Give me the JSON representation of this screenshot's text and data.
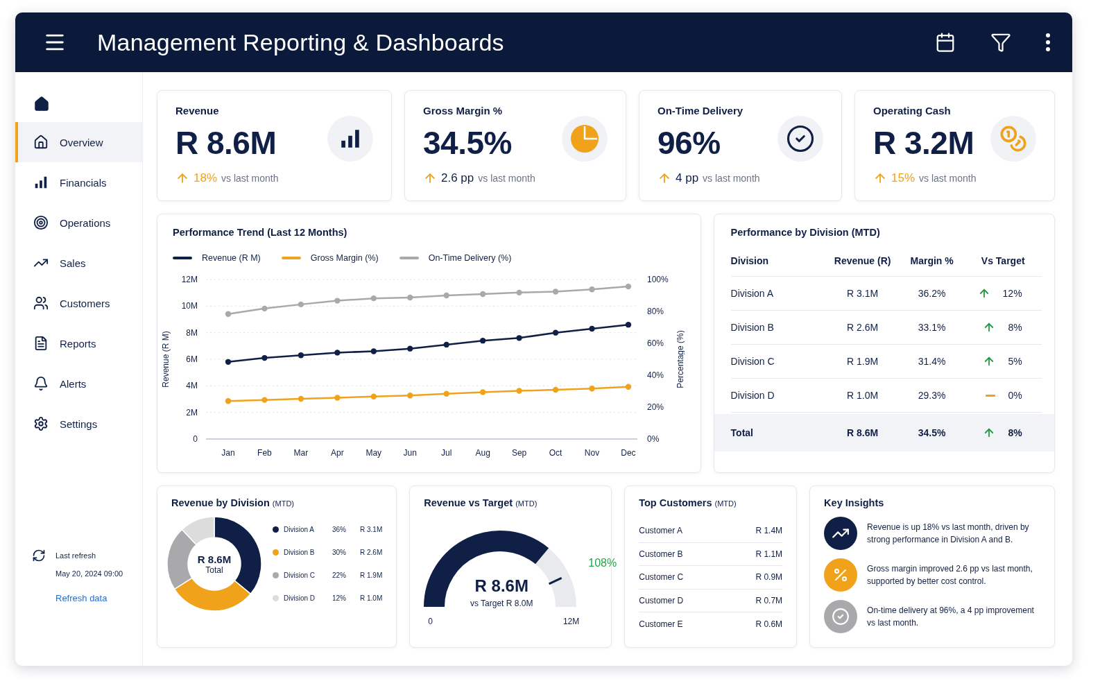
{
  "header": {
    "title": "Management Reporting & Dashboards"
  },
  "sidebar": {
    "items": [
      {
        "label": "Overview",
        "kind": "home",
        "selected": true
      },
      {
        "label": "Financials",
        "kind": "bars",
        "selected": false
      },
      {
        "label": "Operations",
        "kind": "target",
        "selected": false
      },
      {
        "label": "Sales",
        "kind": "trend",
        "selected": false
      },
      {
        "label": "Customers",
        "kind": "users",
        "selected": false
      },
      {
        "label": "Reports",
        "kind": "file",
        "selected": false
      },
      {
        "label": "Alerts",
        "kind": "bell",
        "selected": false
      },
      {
        "label": "Settings",
        "kind": "gear",
        "selected": false
      }
    ],
    "footer": {
      "label": "Last refresh",
      "timestamp": "May 20, 2024 09:00",
      "link": "Refresh data"
    }
  },
  "kpis": [
    {
      "label": "Revenue",
      "value": "R 8.6M",
      "kind": "bars",
      "delta": "18%",
      "highlight": true,
      "suffix": "vs last month"
    },
    {
      "label": "Gross Margin %",
      "value": "34.5%",
      "kind": "pie",
      "delta": "2.6 pp",
      "highlight": false,
      "suffix": "vs last month"
    },
    {
      "label": "On-Time Delivery",
      "value": "96%",
      "kind": "check",
      "delta": "4 pp",
      "highlight": false,
      "suffix": "vs last month"
    },
    {
      "label": "Operating Cash",
      "value": "R 3.2M",
      "kind": "coins",
      "delta": "15%",
      "highlight": true,
      "suffix": "vs last month"
    }
  ],
  "trend": {
    "title": "Performance Trend (Last 12 Months)",
    "chart_data": {
      "type": "line",
      "ylabel": "Revenue (R M)",
      "y2label": "Percentage (%)",
      "grid": true,
      "categories": [
        "Jan",
        "Feb",
        "Mar",
        "Apr",
        "May",
        "Jun",
        "Jul",
        "Aug",
        "Sep",
        "Oct",
        "Nov",
        "Dec"
      ],
      "ylim": [
        0,
        12
      ],
      "yticks": [
        {
          "value": 0,
          "label": "0"
        },
        {
          "value": 2,
          "label": "2M"
        },
        {
          "value": 4,
          "label": "4M"
        },
        {
          "value": 6,
          "label": "6M"
        },
        {
          "value": 8,
          "label": "8M"
        },
        {
          "value": 10,
          "label": "10M"
        },
        {
          "value": 12,
          "label": "12M"
        }
      ],
      "y2lim": [
        0,
        100
      ],
      "y2ticks": [
        {
          "value": 0,
          "label": "0%"
        },
        {
          "value": 20,
          "label": "20%"
        },
        {
          "value": 40,
          "label": "40%"
        },
        {
          "value": 60,
          "label": "60%"
        },
        {
          "value": 80,
          "label": "80%"
        },
        {
          "value": 100,
          "label": "100%"
        }
      ],
      "series": [
        {
          "name": "Revenue (R M)",
          "color": "#0f1f45",
          "marker": true,
          "values": [
            5.8,
            6.1,
            6.3,
            6.5,
            6.6,
            6.8,
            7.1,
            7.4,
            7.6,
            8.0,
            8.3,
            8.6
          ]
        },
        {
          "name": "Gross Margin (%)",
          "color": "#f0a21b",
          "axis": "y2",
          "marker": true,
          "values": [
            23.8,
            24.5,
            25.2,
            25.9,
            26.6,
            27.3,
            28.4,
            29.4,
            30.2,
            30.9,
            31.6,
            32.7
          ]
        },
        {
          "name": "On-Time Delivery (%)",
          "color": "#a9a9ab",
          "axis": "y2",
          "marker": true,
          "values": [
            78.4,
            81.8,
            84.4,
            86.7,
            88.2,
            88.7,
            90,
            90.9,
            91.8,
            92.4,
            93.8,
            95.6
          ]
        }
      ]
    }
  },
  "division_table": {
    "title": "Performance by Division (MTD)",
    "columns": [
      "Division",
      "Revenue (R)",
      "Margin %",
      "Vs Target"
    ],
    "rows": [
      {
        "cells": [
          "Division A",
          "R 3.1M",
          "36.2%"
        ],
        "kind": "up",
        "change": "12%",
        "total": false
      },
      {
        "cells": [
          "Division B",
          "R 2.6M",
          "33.1%"
        ],
        "kind": "up",
        "change": "8%",
        "total": false
      },
      {
        "cells": [
          "Division C",
          "R 1.9M",
          "31.4%"
        ],
        "kind": "up",
        "change": "5%",
        "total": false
      },
      {
        "cells": [
          "Division D",
          "R 1.0M",
          "29.3%"
        ],
        "kind": "flat",
        "change": "0%",
        "total": false
      },
      {
        "cells": [
          "Total",
          "R 8.6M",
          "34.5%"
        ],
        "kind": "up",
        "change": "8%",
        "total": true
      }
    ]
  },
  "revenue_by_division": {
    "title": "Revenue by Division",
    "tag": "(MTD)",
    "center_value": "R 8.6M",
    "center_label": "Total",
    "chart_data": {
      "type": "donut",
      "categories": [
        "Division A",
        "Division B",
        "Division C",
        "Division D"
      ],
      "values": [
        36,
        30,
        22,
        12
      ]
    },
    "legend": [
      {
        "color": "#0f1f45",
        "share": "36%",
        "amount": "R 3.1M"
      },
      {
        "color": "#f0a21b",
        "share": "30%",
        "amount": "R 2.6M"
      },
      {
        "color": "#a9a9ab",
        "share": "22%",
        "amount": "R 1.9M"
      },
      {
        "color": "#dcdcdc",
        "share": "12%",
        "amount": "R 1.0M"
      }
    ]
  },
  "revenue_vs_target": {
    "title": "Revenue vs Target",
    "tag": "(MTD)",
    "value": "R 8.6M",
    "caption": "vs Target R 8.0M",
    "min_label": "0",
    "max_label": "12M",
    "percent": "108%"
  },
  "top_customers": {
    "title": "Top Customers",
    "tag": "(MTD)",
    "rows": [
      {
        "name": "Customer A",
        "value": "R 1.4M"
      },
      {
        "name": "Customer B",
        "value": "R 1.1M"
      },
      {
        "name": "Customer C",
        "value": "R 0.9M"
      },
      {
        "name": "Customer D",
        "value": "R 0.7M"
      },
      {
        "name": "Customer E",
        "value": "R 0.6M"
      }
    ]
  },
  "insights": {
    "title": "Key Insights",
    "items": [
      {
        "kind": "trend",
        "color": "#0f1f45",
        "text": "Revenue is up 18% vs last month, driven by strong performance in Division A and B."
      },
      {
        "kind": "percent",
        "color": "#f0a21b",
        "text": "Gross margin improved 2.6 pp vs last month, supported by better cost control."
      },
      {
        "kind": "check",
        "color": "#a9a9ab",
        "text": "On-time delivery at 96%, a 4 pp improvement vs last month."
      }
    ]
  }
}
